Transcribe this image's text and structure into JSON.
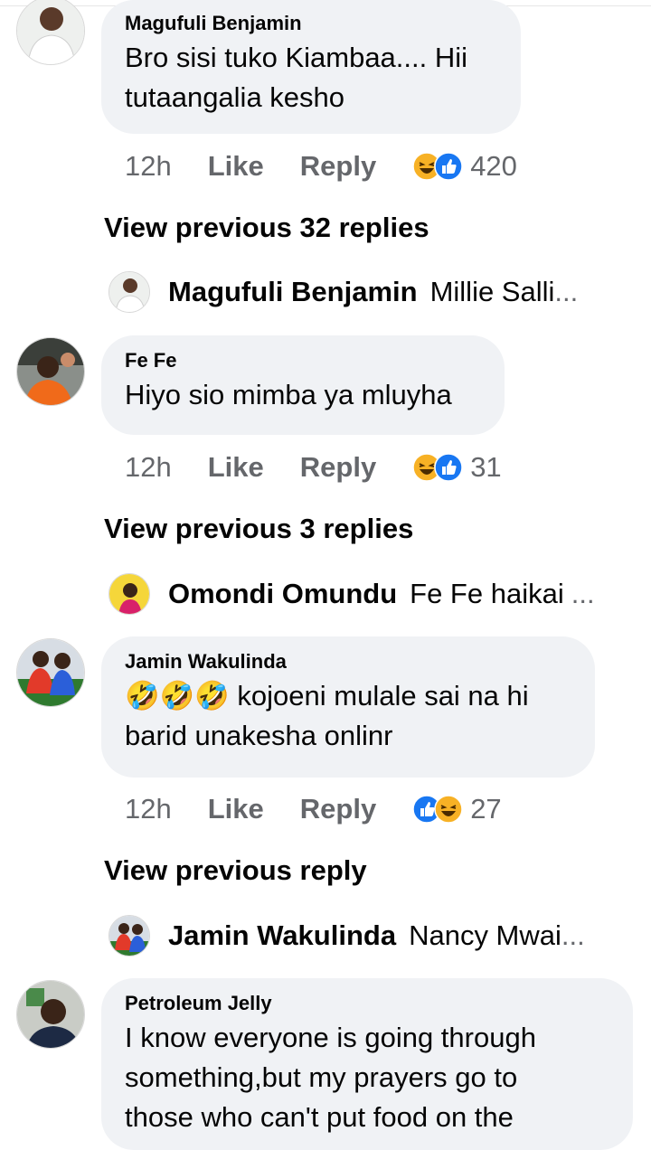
{
  "comments": [
    {
      "author": "Magufuli Benjamin",
      "lines": [
        "Bro sisi tuko Kiambaa.... Hii",
        "tutaangalia kesho"
      ],
      "time": "12h",
      "like_label": "Like",
      "reply_label": "Reply",
      "reactions": [
        "haha-icon",
        "like-icon"
      ],
      "reaction_count": "420",
      "view_previous": "View previous 32 replies",
      "reply_preview": {
        "author": "Magufuli Benjamin",
        "text": "Millie Salli",
        "ellipsis": "..."
      }
    },
    {
      "author": "Fe Fe",
      "lines": [
        "Hiyo sio mimba ya mluyha"
      ],
      "time": "12h",
      "like_label": "Like",
      "reply_label": "Reply",
      "reactions": [
        "haha-icon",
        "like-icon"
      ],
      "reaction_count": "31",
      "view_previous": "View previous 3 replies",
      "reply_preview": {
        "author": "Omondi Omundu",
        "text": "Fe Fe haikai",
        "ellipsis": "..."
      }
    },
    {
      "author": "Jamin Wakulinda",
      "lines": [
        "🤣🤣🤣 kojoeni mulale sai na hi",
        "barid unakesha onlinr"
      ],
      "time": "12h",
      "like_label": "Like",
      "reply_label": "Reply",
      "reactions": [
        "like-icon",
        "haha-icon"
      ],
      "reaction_count": "27",
      "view_previous": "View previous reply",
      "reply_preview": {
        "author": "Jamin Wakulinda",
        "text": "Nancy Mwai",
        "ellipsis": "..."
      }
    },
    {
      "author": "Petroleum Jelly",
      "lines": [
        "I know everyone is going through",
        "something,but my prayers go to",
        "those who can't put food on the"
      ]
    }
  ],
  "colors": {
    "bubble": "#f0f2f5",
    "meta_text": "#65676b",
    "like_blue": "#1877f2",
    "haha_yellow": "#f7b125"
  }
}
